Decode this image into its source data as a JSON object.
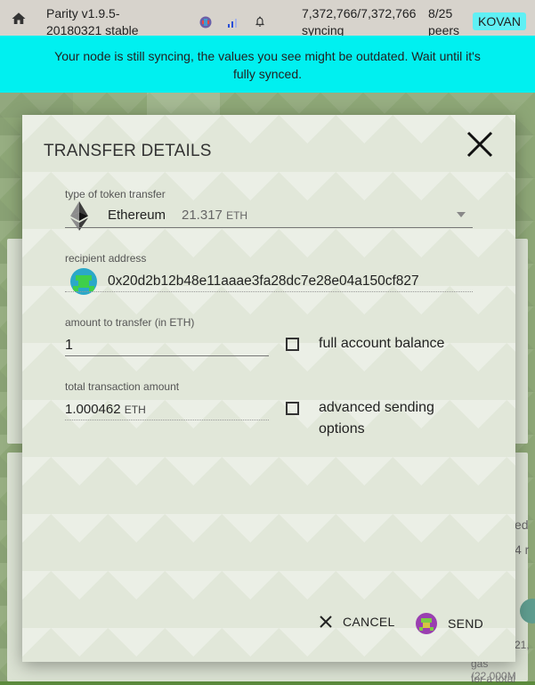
{
  "statusbar": {
    "version_line1": "Parity v1.9.5-",
    "version_line2": "20180321 stable",
    "sync_line1": "7,372,766/7,372,766",
    "sync_line2": "syncing",
    "peers_line1": "8/25",
    "peers_line2": "peers",
    "chain": "KOVAN"
  },
  "sync_warning": "Your node is still syncing, the values you see might be outdated. Wait until it's fully synced.",
  "background": {
    "text_right1": "ed",
    "text_right2": "4 r",
    "text_right3": "21,",
    "text_bottom1": "gas (22,000M",
    "text_bottom2": "for a total"
  },
  "modal": {
    "title": "TRANSFER DETAILS",
    "token": {
      "label": "type of token transfer",
      "name": "Ethereum",
      "balance": "21.317",
      "unit": "ETH"
    },
    "recipient": {
      "label": "recipient address",
      "address": "0x20d2b12b48e11aaae3fa28dc7e28e04a150cf827"
    },
    "amount": {
      "label": "amount to transfer (in ETH)",
      "value": "1"
    },
    "full_balance_label": "full account balance",
    "total": {
      "label": "total transaction amount",
      "value": "1.000462",
      "unit": "ETH"
    },
    "advanced_line1": "advanced sending",
    "advanced_line2": "options",
    "cancel_label": "CANCEL",
    "send_label": "SEND"
  },
  "colors": {
    "sync_banner": "#00f0f0",
    "chain_badge": "#5ff0f4",
    "background_green": "#688a4a"
  }
}
